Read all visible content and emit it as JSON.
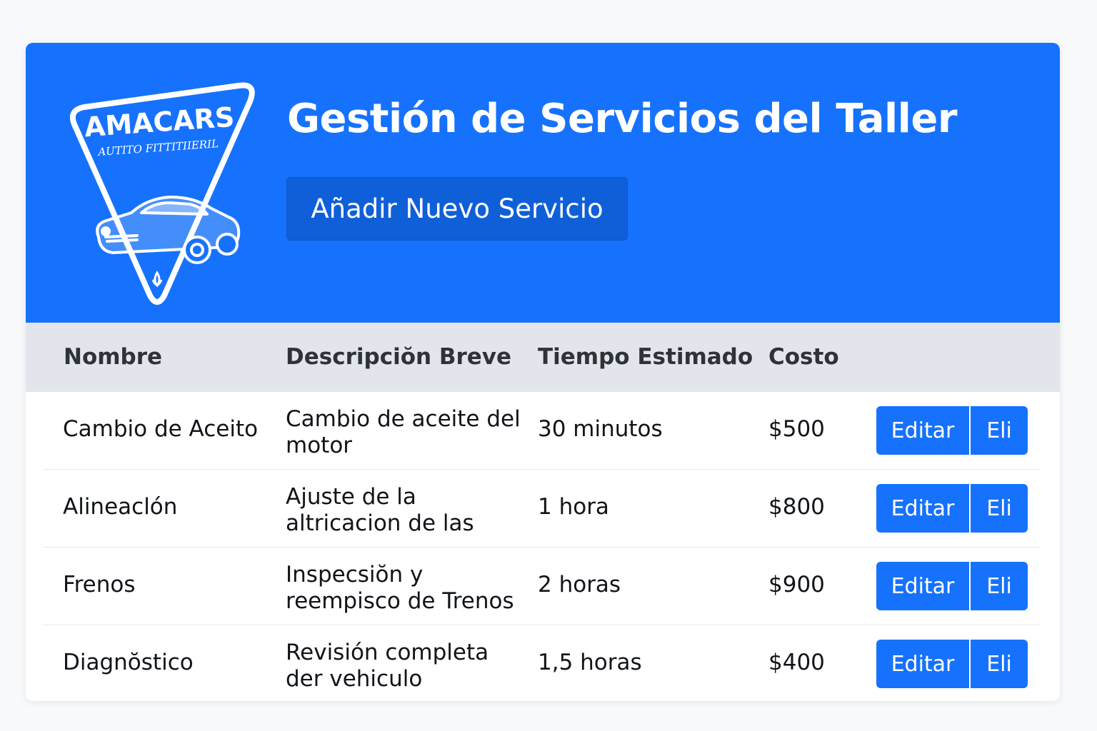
{
  "logo": {
    "brand": "AMACARS",
    "tagline": "AUTITO FITTITIIERIL"
  },
  "header": {
    "title": "Gestión de Servicios del Taller",
    "add_button": "Añadir Nuevo Servicio",
    "background_color": "#1672fc"
  },
  "table": {
    "columns": [
      "Nombre",
      "Descripciŏn Breve",
      "Tiempo Estimado",
      "Costo"
    ],
    "rows": [
      {
        "name": "Cambio de Aceito",
        "desc": "Cambio de aceite del motor",
        "time": "30 minutos",
        "cost": "$500"
      },
      {
        "name": "Alineaclón",
        "desc": "Ajuste de la altricacion de las",
        "time": "1 hora",
        "cost": "$800"
      },
      {
        "name": "Frenos",
        "desc": "Inspecsiŏn y reempisco de Trenos",
        "time": "2 horas",
        "cost": "$900"
      },
      {
        "name": "Diagnŏstico",
        "desc": "Revisión completa der vehiculo",
        "time": "1,5 horas",
        "cost": "$400"
      }
    ],
    "actions": {
      "edit": "Editar",
      "delete": "Eli"
    }
  }
}
